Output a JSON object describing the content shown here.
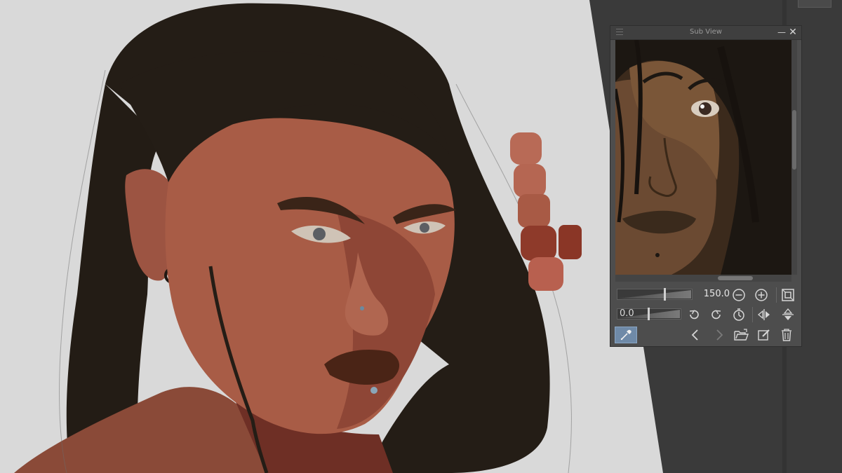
{
  "app": {
    "panel_title": "Sub View"
  },
  "zoom": {
    "value_label": "150.0",
    "value": 150.0
  },
  "rotation": {
    "value_label": "0.0",
    "value": 0.0
  },
  "icons": {
    "panel_menu": "hamburger-icon",
    "minimize": "minimize-icon",
    "close": "close-icon",
    "zoom_out": "zoom-out-icon",
    "zoom_in": "zoom-in-icon",
    "fit": "fit-to-view-icon",
    "rotate_left": "rotate-left-icon",
    "rotate_right": "rotate-right-icon",
    "reset_rotation": "reset-rotation-icon",
    "flip_horizontal": "flip-horizontal-icon",
    "flip_vertical": "flip-vertical-icon",
    "eyedropper": "eyedropper-icon",
    "previous": "chevron-left-icon",
    "next": "chevron-right-icon",
    "open_image": "open-folder-icon",
    "import_image": "edit-icon",
    "delete_image": "trash-icon"
  },
  "colors": {
    "panel_bg": "#4d4d4d",
    "titlebar_bg": "#3f3f3f",
    "active_tool": "#6f8aa8",
    "canvas_bg": "#d9d9d9",
    "swatches": [
      "#b86a56",
      "#b56652",
      "#a85a45",
      "#8e3a2a",
      "#8a3626",
      "#b8604f"
    ]
  }
}
